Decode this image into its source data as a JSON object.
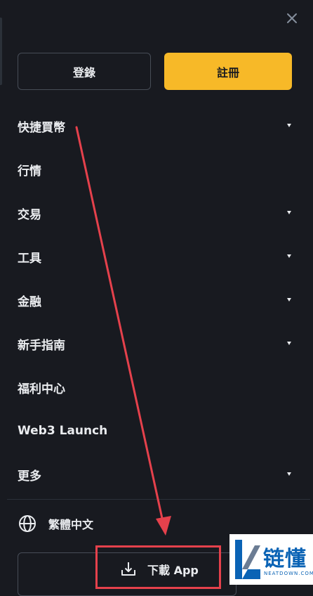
{
  "header": {
    "close_icon": "close-icon"
  },
  "auth": {
    "login_label": "登錄",
    "register_label": "註冊"
  },
  "menu": [
    {
      "label": "快捷買幣",
      "has_caret": true
    },
    {
      "label": "行情",
      "has_caret": false
    },
    {
      "label": "交易",
      "has_caret": true
    },
    {
      "label": "工具",
      "has_caret": true
    },
    {
      "label": "金融",
      "has_caret": true
    },
    {
      "label": "新手指南",
      "has_caret": true
    },
    {
      "label": "福利中心",
      "has_caret": false
    },
    {
      "label": "Web3 Launch",
      "has_caret": false
    },
    {
      "label": "更多",
      "has_caret": true
    }
  ],
  "language": {
    "icon": "globe-icon",
    "label": "繁體中文"
  },
  "download": {
    "icon": "download-icon",
    "label": "下載 App"
  },
  "watermark": {
    "text": "链懂",
    "sub": "NEATDOWN.COM"
  },
  "colors": {
    "background": "#181a20",
    "accent": "#f7b928",
    "annotation": "#e5414c",
    "text": "#eaecef"
  }
}
